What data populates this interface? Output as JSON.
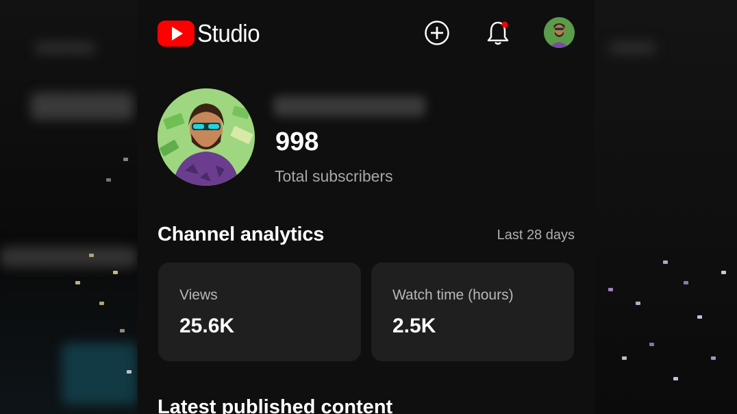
{
  "header": {
    "app_name": "Studio",
    "icons": {
      "logo": "youtube-play-icon",
      "create": "plus-circle-icon",
      "notifications": "bell-icon",
      "account": "avatar"
    },
    "accent_color": "#ff0000"
  },
  "channel": {
    "subscriber_count": "998",
    "subscriber_label": "Total subscribers"
  },
  "analytics": {
    "title": "Channel analytics",
    "period": "Last 28 days",
    "cards": [
      {
        "label": "Views",
        "value": "25.6K"
      },
      {
        "label": "Watch time (hours)",
        "value": "2.5K"
      }
    ]
  },
  "latest": {
    "title": "Latest published content"
  }
}
